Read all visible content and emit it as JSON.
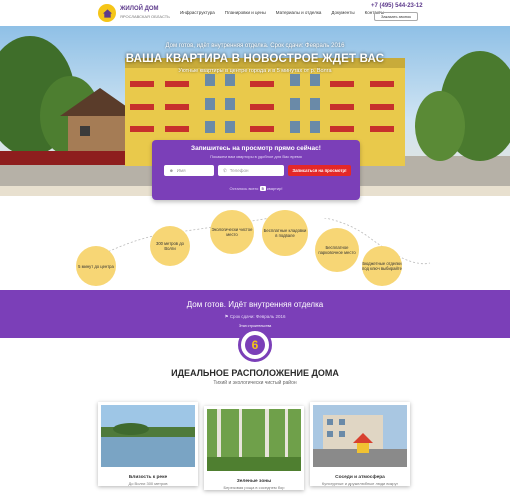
{
  "header": {
    "brand_title": "ЖИЛОЙ ДОМ",
    "brand_subtitle": "ЯРОСЛАВСКАЯ ОБЛАСТЬ",
    "nav": [
      "Инфраструктура",
      "Планировки и цены",
      "Материалы и отделка",
      "Документы",
      "Контакты"
    ],
    "phone": "+7 (495) 544-23-12",
    "callback_label": "Заказать звонок"
  },
  "hero": {
    "subtitle": "Дом готов, идёт внутренняя отделка. Срок сдачи: Февраль 2016",
    "title": "ВАША КВАРТИРА В НОВОСТРОЕ ЖДЕТ ВАС",
    "desc_line1": "Уютные квартиры в центре города и в 5 минутах от р. Волга",
    "desc_line2": ""
  },
  "form": {
    "title": "Запишитесь на просмотр прямо сейчас!",
    "subtitle": "Покажем вам квартиры в удобное для Вас время",
    "name_placeholder": "Имя",
    "phone_placeholder": "Телефон",
    "submit_label": "Записаться на просмотр!",
    "bottom_text_before": "Осталось всего",
    "bottom_count": "5",
    "bottom_text_after": "квартир!"
  },
  "features": [
    {
      "label": "5 минут до центра"
    },
    {
      "label": "300 метров до Волги"
    },
    {
      "label": "Экологически чистое место"
    },
    {
      "label": "Бесплатные кладовки в подвале"
    },
    {
      "label": "Бесплатное парковочное место"
    },
    {
      "label": "Бюджетные отделки под ключ выбирайте"
    }
  ],
  "band": {
    "title": "Дом готов. Идёт внутренняя отделка",
    "subtitle": "Срок сдачи: Февраль 2016",
    "badge_caption": "Этап строительства",
    "badge_value": "6"
  },
  "location": {
    "title": "ИДЕАЛЬНОЕ РАСПОЛОЖЕНИЕ ДОМА",
    "subtitle": "Тихий и экологически чистый район",
    "cards": [
      {
        "title": "Близость к реке",
        "desc": "До Волги 300 метров"
      },
      {
        "title": "Зеленые зоны",
        "desc": "Березовая роща в соседнем бор"
      },
      {
        "title": "Соседи и атмосфера",
        "desc": "Культурные и дружелюбные люди вокруг"
      }
    ]
  },
  "colors": {
    "purple": "#7b3fb8",
    "yellow": "#f7d675",
    "red": "#e42828"
  }
}
